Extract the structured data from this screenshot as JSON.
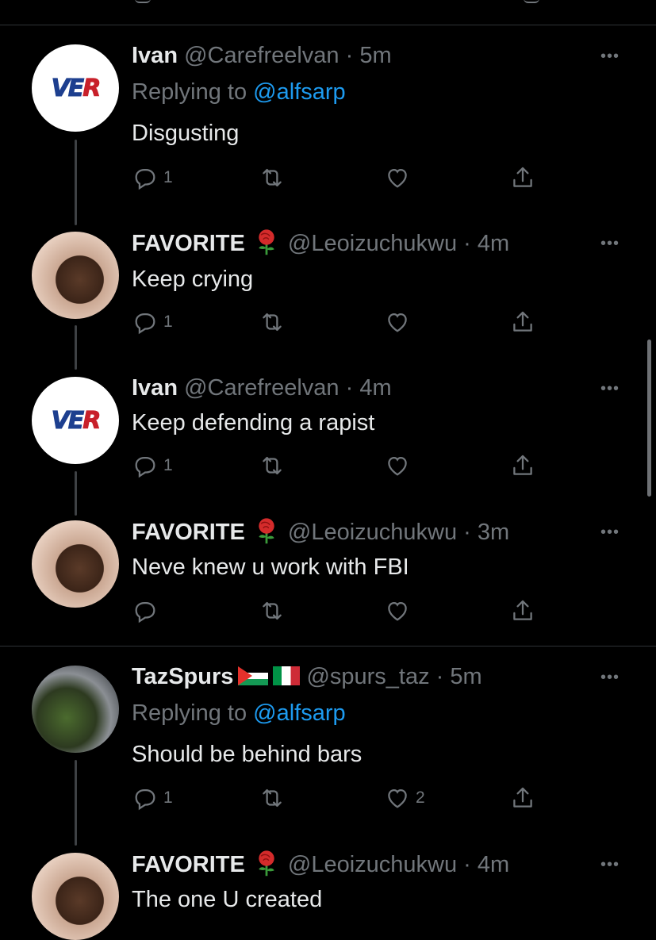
{
  "tweets": [
    {
      "name": "Ivan",
      "handle": "@Carefreelvan",
      "time": "5m",
      "replying_prefix": "Replying to ",
      "replying_to": "@alfsarp",
      "text": "Disgusting",
      "avatar": "ver-logo",
      "counts": {
        "reply": "1",
        "retweet": "",
        "like": ""
      }
    },
    {
      "name": "FAVORITE",
      "handle": "@Leoizuchukwu",
      "time": "4m",
      "text": "Keep crying",
      "avatar": "profile-photo",
      "counts": {
        "reply": "1",
        "retweet": "",
        "like": ""
      }
    },
    {
      "name": "Ivan",
      "handle": "@Carefreelvan",
      "time": "4m",
      "text": "Keep defending a rapist",
      "avatar": "ver-logo",
      "counts": {
        "reply": "1",
        "retweet": "",
        "like": ""
      }
    },
    {
      "name": "FAVORITE",
      "handle": "@Leoizuchukwu",
      "time": "3m",
      "text": "Neve knew u work with FBI",
      "avatar": "profile-photo",
      "counts": {
        "reply": "",
        "retweet": "",
        "like": ""
      }
    },
    {
      "name": "TazSpurs",
      "handle": "@spurs_taz",
      "time": "5m",
      "replying_prefix": "Replying to ",
      "replying_to": "@alfsarp",
      "text": "Should be behind bars",
      "avatar": "photo",
      "counts": {
        "reply": "1",
        "retweet": "",
        "like": "2"
      }
    },
    {
      "name": "FAVORITE",
      "handle": "@Leoizuchukwu",
      "time": "4m",
      "text": "The one U created",
      "avatar": "profile-photo"
    }
  ],
  "ver_logo": {
    "ve": "VE",
    "r": "R"
  },
  "separator": " · ",
  "more_glyph": "•••",
  "icons": {
    "reply": "reply-icon",
    "retweet": "retweet-icon",
    "like": "like-icon",
    "share": "share-icon",
    "more": "more-icon",
    "rose": "rose-emoji-icon",
    "flags": [
      "palestine-flag-icon",
      "italy-flag-icon"
    ]
  },
  "colors": {
    "background": "#000000",
    "text": "#e7e9ea",
    "secondary": "#71767b",
    "accent": "#1d9bf0",
    "divider": "#2f3336"
  }
}
